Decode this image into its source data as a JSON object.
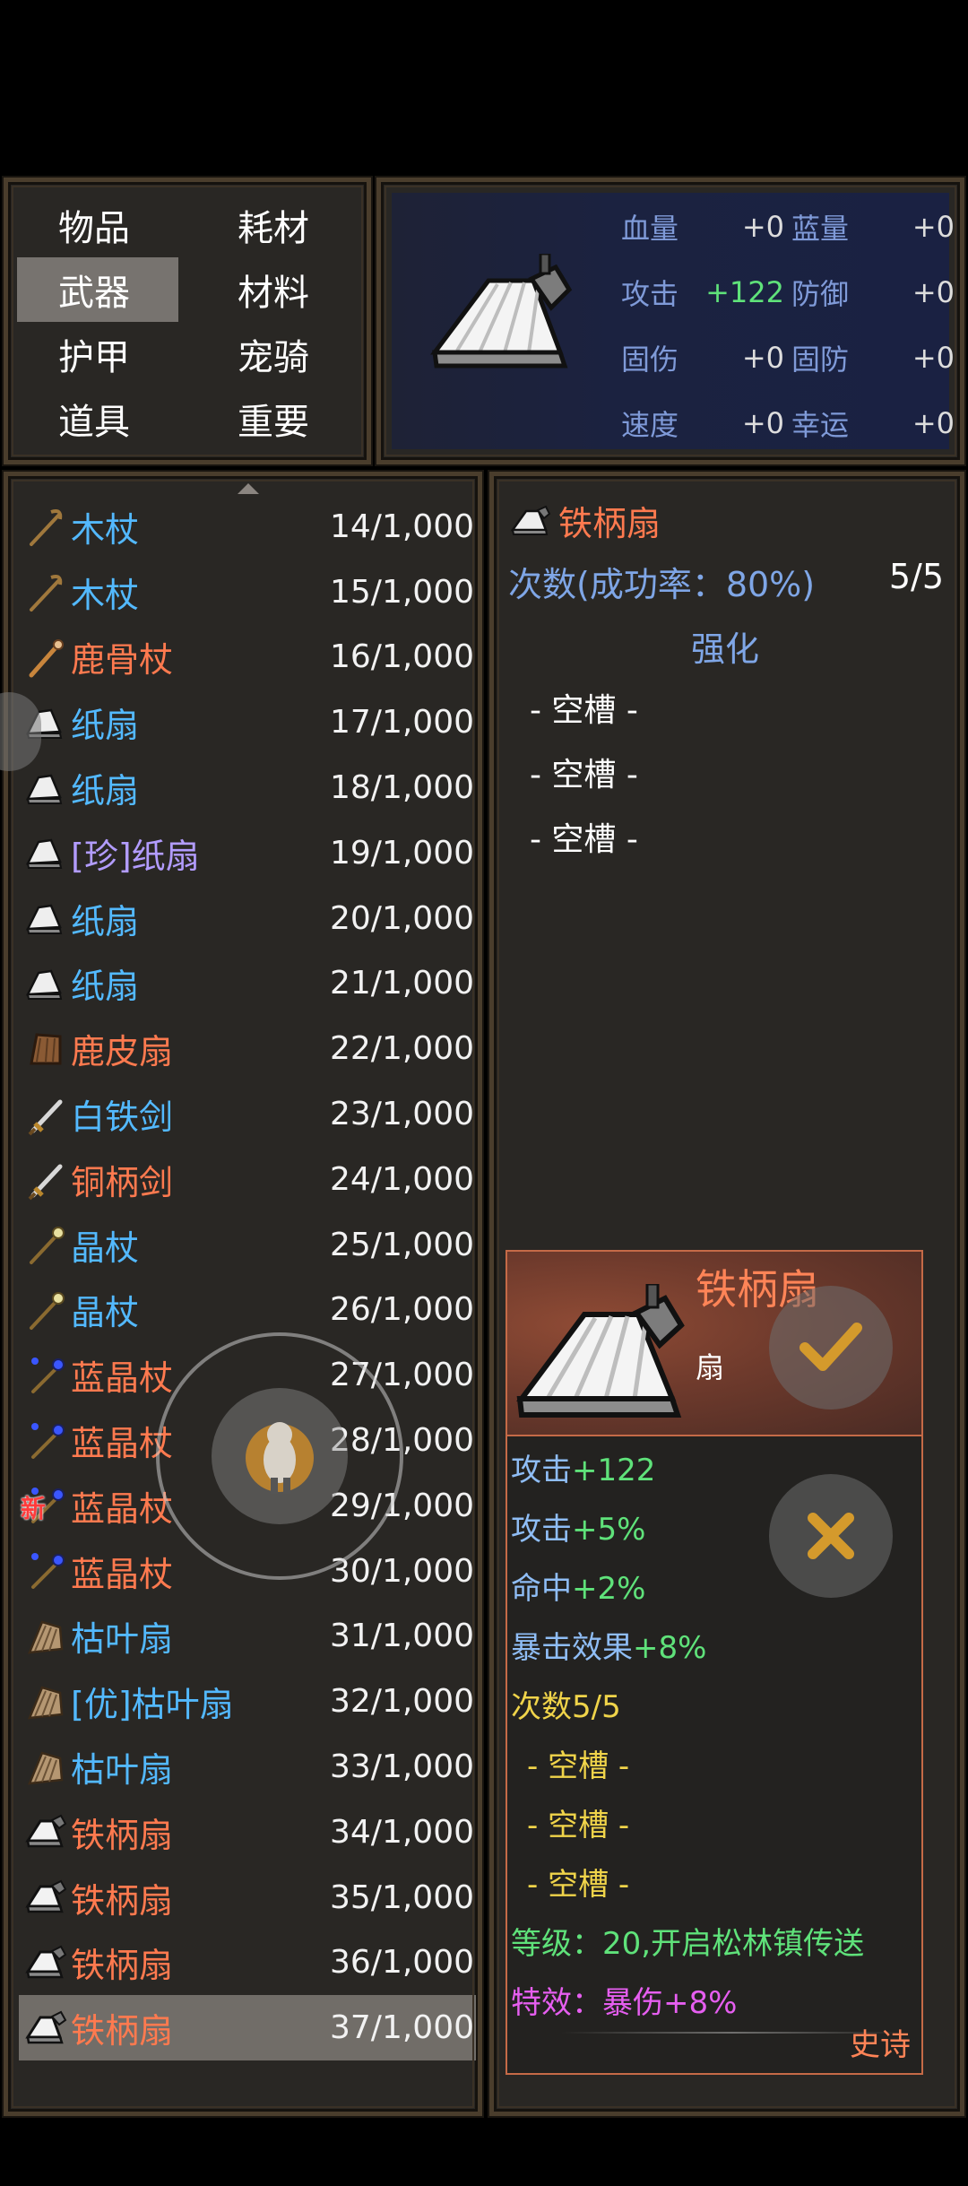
{
  "categories": [
    {
      "label": "物品",
      "active": false
    },
    {
      "label": "耗材",
      "active": false
    },
    {
      "label": "武器",
      "active": true
    },
    {
      "label": "材料",
      "active": false
    },
    {
      "label": "护甲",
      "active": false
    },
    {
      "label": "宠骑",
      "active": false
    },
    {
      "label": "道具",
      "active": false
    },
    {
      "label": "重要",
      "active": false
    }
  ],
  "stats": [
    {
      "label": "血量",
      "value": "+0",
      "label2": "蓝量",
      "value2": "+0",
      "green": false
    },
    {
      "label": "攻击",
      "value": "+122",
      "label2": "防御",
      "value2": "+0",
      "green": true
    },
    {
      "label": "固伤",
      "value": "+0",
      "label2": "固防",
      "value2": "+0",
      "green": false
    },
    {
      "label": "速度",
      "value": "+0",
      "label2": "幸运",
      "value2": "+0",
      "green": false
    }
  ],
  "items": [
    {
      "name": "木杖",
      "count": "14/1,000",
      "color": "blue",
      "icon": "staff-icon"
    },
    {
      "name": "木杖",
      "count": "15/1,000",
      "color": "blue",
      "icon": "staff-icon"
    },
    {
      "name": "鹿骨杖",
      "count": "16/1,000",
      "color": "orange",
      "icon": "bone-staff-icon"
    },
    {
      "name": "纸扇",
      "count": "17/1,000",
      "color": "blue",
      "icon": "fan-icon"
    },
    {
      "name": "纸扇",
      "count": "18/1,000",
      "color": "blue",
      "icon": "fan-icon"
    },
    {
      "name": "[珍]纸扇",
      "count": "19/1,000",
      "color": "purple",
      "icon": "fan-icon"
    },
    {
      "name": "纸扇",
      "count": "20/1,000",
      "color": "blue",
      "icon": "fan-icon"
    },
    {
      "name": "纸扇",
      "count": "21/1,000",
      "color": "blue",
      "icon": "fan-icon"
    },
    {
      "name": "鹿皮扇",
      "count": "22/1,000",
      "color": "orange",
      "icon": "leather-fan-icon"
    },
    {
      "name": "白铁剑",
      "count": "23/1,000",
      "color": "blue",
      "icon": "sword-icon"
    },
    {
      "name": "铜柄剑",
      "count": "24/1,000",
      "color": "orange",
      "icon": "sword-icon"
    },
    {
      "name": "晶杖",
      "count": "25/1,000",
      "color": "blue",
      "icon": "crystal-staff-icon"
    },
    {
      "name": "晶杖",
      "count": "26/1,000",
      "color": "blue",
      "icon": "crystal-staff-icon"
    },
    {
      "name": "蓝晶杖",
      "count": "27/1,000",
      "color": "orange",
      "icon": "blue-crystal-staff-icon"
    },
    {
      "name": "蓝晶杖",
      "count": "28/1,000",
      "color": "orange",
      "icon": "blue-crystal-staff-icon"
    },
    {
      "name": "蓝晶杖",
      "count": "29/1,000",
      "color": "orange",
      "icon": "blue-crystal-staff-icon",
      "new": "新"
    },
    {
      "name": "蓝晶杖",
      "count": "30/1,000",
      "color": "orange",
      "icon": "blue-crystal-staff-icon"
    },
    {
      "name": "枯叶扇",
      "count": "31/1,000",
      "color": "blue",
      "icon": "leaf-fan-icon"
    },
    {
      "name": "[优]枯叶扇",
      "count": "32/1,000",
      "color": "blue",
      "icon": "leaf-fan-icon"
    },
    {
      "name": "枯叶扇",
      "count": "33/1,000",
      "color": "blue",
      "icon": "leaf-fan-icon"
    },
    {
      "name": "铁柄扇",
      "count": "34/1,000",
      "color": "orange",
      "icon": "iron-fan-icon"
    },
    {
      "name": "铁柄扇",
      "count": "35/1,000",
      "color": "orange",
      "icon": "iron-fan-icon"
    },
    {
      "name": "铁柄扇",
      "count": "36/1,000",
      "color": "orange",
      "icon": "iron-fan-icon"
    },
    {
      "name": "铁柄扇",
      "count": "37/1,000",
      "color": "orange",
      "icon": "iron-fan-icon",
      "selected": true
    }
  ],
  "detail": {
    "name": "铁柄扇",
    "times_label": "次数(成功率：80%)",
    "times_value": "5/5",
    "enhance": "强化",
    "slots": [
      "- 空槽 -",
      "- 空槽 -",
      "- 空槽 -"
    ]
  },
  "tooltip": {
    "name": "铁柄扇",
    "type": "扇",
    "stats": [
      {
        "k": "攻击",
        "v": "+122"
      },
      {
        "k": "攻击",
        "v": "+5%"
      },
      {
        "k": "命中",
        "v": "+2%"
      },
      {
        "k": "暴击效果",
        "v": "+8%"
      }
    ],
    "times_label": "次数",
    "times_value": "5/5",
    "slots": [
      "- 空槽 -",
      "- 空槽 -",
      "- 空槽 -"
    ],
    "level": "等级：20,开启松林镇传送",
    "effect": "特效：暴伤+8%",
    "rarity": "史诗"
  },
  "colors": {
    "orange": "#ff7a4f",
    "blue": "#53b9ff",
    "purple": "#b29cff",
    "green": "#5fe27a",
    "yellow": "#f0d44a",
    "magenta": "#e65ef0"
  }
}
